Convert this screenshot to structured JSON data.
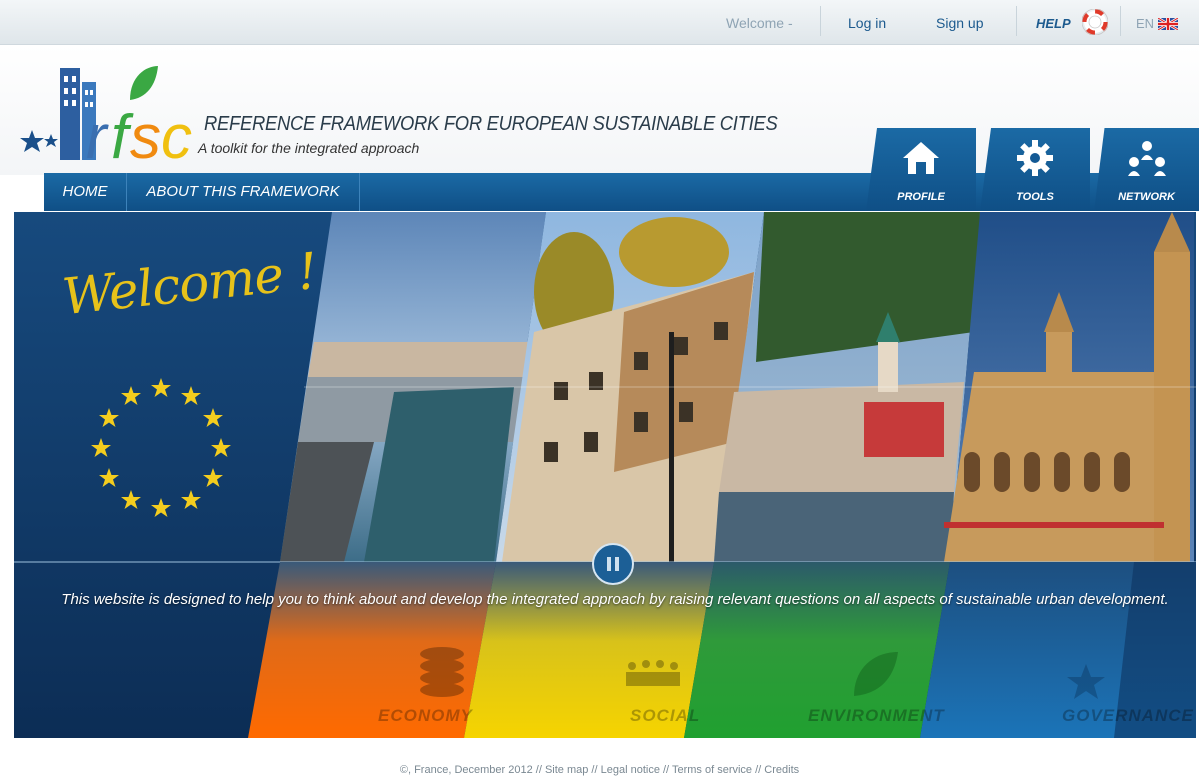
{
  "topbar": {
    "welcome": "Welcome -",
    "login": "Log in",
    "signup": "Sign up",
    "help": "HELP",
    "lang": "EN"
  },
  "header": {
    "logo_text": "rfsc",
    "title": "REFERENCE FRAMEWORK FOR EUROPEAN SUSTAINABLE CITIES",
    "subtitle": "A toolkit for the integrated approach"
  },
  "nav": {
    "items": [
      {
        "label": "HOME"
      },
      {
        "label": "ABOUT THIS FRAMEWORK"
      }
    ],
    "tabs": [
      {
        "label": "PROFILE",
        "icon": "house-icon"
      },
      {
        "label": "TOOLS",
        "icon": "gear-icon"
      },
      {
        "label": "NETWORK",
        "icon": "people-icon"
      }
    ]
  },
  "hero": {
    "welcome": "Welcome !",
    "text": "This website is designed to help you to think about and develop the integrated approach by raising relevant questions on all aspects of sustainable urban development.",
    "categories": [
      {
        "label": "ECONOMY",
        "color": "#f06a0a",
        "icon": "coins-icon"
      },
      {
        "label": "SOCIAL",
        "color": "#f0c80a",
        "icon": "people-group-icon"
      },
      {
        "label": "ENVIRONMENT",
        "color": "#2fa040",
        "icon": "leaf-icon"
      },
      {
        "label": "GOVERNANCE",
        "color": "#1a6fa8",
        "icon": "star-icon"
      }
    ]
  },
  "footer": {
    "copyright": "©, France, December 2012",
    "links": [
      "Site map",
      "Legal notice",
      "Terms of service",
      "Credits"
    ],
    "separator": " // "
  },
  "colors": {
    "brand_blue": "#0f4f86",
    "eu_gold": "#f4cd1e",
    "dark_navy": "#0e3360"
  }
}
